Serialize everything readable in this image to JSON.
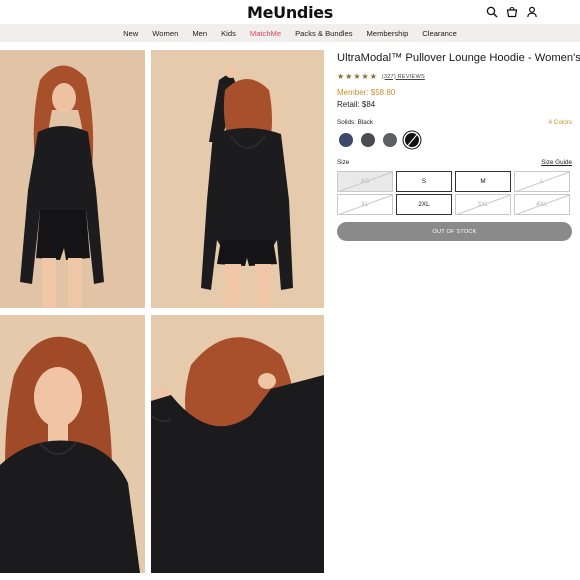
{
  "header": {
    "logo": "MeUndies",
    "icons": [
      "search-icon",
      "bag-icon",
      "user-icon"
    ]
  },
  "nav": {
    "items": [
      "New",
      "Women",
      "Men",
      "Kids",
      "MatchMe",
      "Packs & Bundles",
      "Membership",
      "Clearance"
    ],
    "accent_item": "MatchMe",
    "accent_color": "#e8425a"
  },
  "gallery": {
    "photo_count": 4
  },
  "product": {
    "title": "UltraModal™ Pullover Lounge Hoodie - Women's",
    "rating": 4.5,
    "reviews": "(327) REVIEWS",
    "member_price": "Member: $58.80",
    "retail_price": "Retail: $84",
    "price_accent_color": "#c8922a"
  },
  "colors": {
    "label": "Solids: Black",
    "count": "4 Colors",
    "swatches": [
      {
        "name": "navy",
        "hex": "#3b4a6b",
        "selected": false
      },
      {
        "name": "charcoal",
        "hex": "#4a4c52",
        "selected": false
      },
      {
        "name": "gray",
        "hex": "#5e5f62",
        "selected": false
      },
      {
        "name": "black",
        "hex": "#111111",
        "selected": true
      }
    ]
  },
  "sizes": {
    "label": "Size",
    "guide": "Size Guide",
    "options": [
      {
        "label": "XS",
        "available": false,
        "shaded": true
      },
      {
        "label": "S",
        "available": true,
        "shaded": false
      },
      {
        "label": "M",
        "available": true,
        "shaded": false
      },
      {
        "label": "L",
        "available": false,
        "shaded": false
      },
      {
        "label": "XL",
        "available": false,
        "shaded": false
      },
      {
        "label": "2XL",
        "available": true,
        "shaded": false
      },
      {
        "label": "3XL",
        "available": false,
        "shaded": false
      },
      {
        "label": "4XL",
        "available": false,
        "shaded": false
      }
    ]
  },
  "cta": {
    "label": "OUT OF STOCK",
    "color": "#8a8a8a"
  }
}
